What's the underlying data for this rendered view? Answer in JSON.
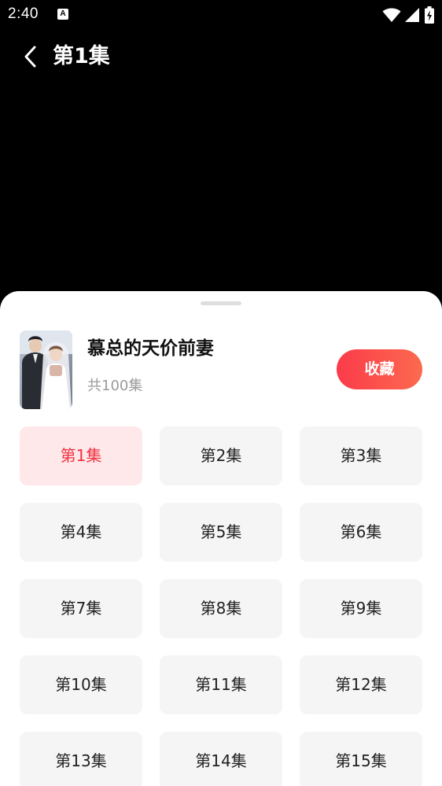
{
  "status_bar": {
    "time": "2:40",
    "notification_icon": "a-icon",
    "wifi_icon": "wifi-icon",
    "signal_icon": "signal-icon",
    "battery_icon": "battery-charging-icon"
  },
  "header": {
    "back_icon": "chevron-left-icon",
    "title": "第1集"
  },
  "drama": {
    "title": "慕总的天价前妻",
    "episode_count": "共100集",
    "collect_label": "收藏"
  },
  "episodes": {
    "active_index": 0,
    "items": [
      {
        "label": "第1集"
      },
      {
        "label": "第2集"
      },
      {
        "label": "第3集"
      },
      {
        "label": "第4集"
      },
      {
        "label": "第5集"
      },
      {
        "label": "第6集"
      },
      {
        "label": "第7集"
      },
      {
        "label": "第8集"
      },
      {
        "label": "第9集"
      },
      {
        "label": "第10集"
      },
      {
        "label": "第11集"
      },
      {
        "label": "第12集"
      },
      {
        "label": "第13集"
      },
      {
        "label": "第14集"
      },
      {
        "label": "第15集"
      }
    ]
  },
  "colors": {
    "accent": "#f0303f",
    "active_bg": "#ffe8e9",
    "cell_bg": "#f5f5f5"
  }
}
